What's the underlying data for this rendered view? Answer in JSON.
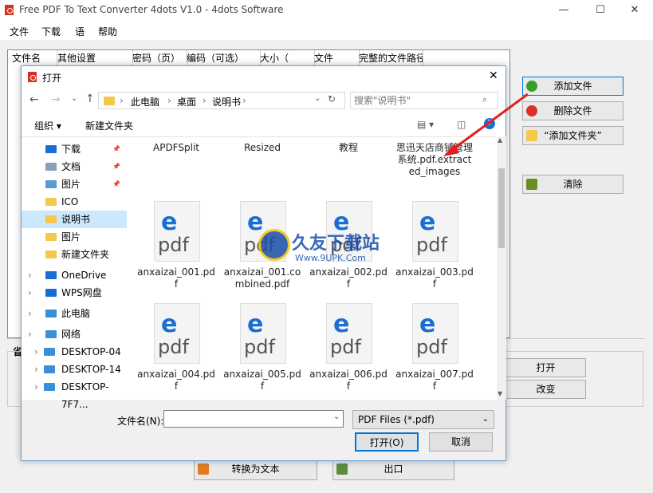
{
  "app": {
    "title": "Free PDF To Text Converter 4dots V1.0 - 4dots Software",
    "menu": [
      "文件",
      "下载",
      "语",
      "帮助"
    ],
    "columns": [
      "文件名",
      "其他设置",
      "密码（页）",
      "编码（可选）",
      "大小（",
      "文件",
      "完整的文件路径"
    ],
    "buttons": {
      "add_file": "添加文件",
      "delete_file": "删除文件",
      "add_folder": "“添加文件夹”",
      "clear": "清除",
      "open": "打开",
      "change": "改变",
      "convert": "转换为文本",
      "exit": "出口"
    },
    "section_marker": "省"
  },
  "dialog": {
    "title": "打开",
    "breadcrumb": [
      "此电脑",
      "桌面",
      "说明书"
    ],
    "search_placeholder": "搜索\"说明书\"",
    "organize": "组织 ▾",
    "new_folder": "新建文件夹",
    "nav": [
      {
        "label": "下载",
        "icon": "download-icon",
        "pinned": true
      },
      {
        "label": "文档",
        "icon": "document-icon",
        "pinned": true
      },
      {
        "label": "图片",
        "icon": "picture-icon",
        "pinned": true
      },
      {
        "label": "ICO",
        "icon": "folder-icon"
      },
      {
        "label": "说明书",
        "icon": "folder-icon",
        "selected": true
      },
      {
        "label": "图片",
        "icon": "folder-icon"
      },
      {
        "label": "新建文件夹",
        "icon": "folder-icon"
      },
      {
        "label": "OneDrive",
        "icon": "cloud-icon"
      },
      {
        "label": "WPS网盘",
        "icon": "cloud-icon"
      },
      {
        "label": "此电脑",
        "icon": "pc-icon"
      },
      {
        "label": "网络",
        "icon": "network-icon"
      },
      {
        "label": "DESKTOP-04",
        "icon": "monitor-icon"
      },
      {
        "label": "DESKTOP-14",
        "icon": "monitor-icon"
      },
      {
        "label": "DESKTOP-7F7...",
        "icon": "monitor-icon"
      }
    ],
    "folders": [
      "APDFSplit",
      "Resized",
      "教程",
      "思迅天店商铺管理系统.pdf.extracted_images"
    ],
    "files": [
      "anxaizai_001.pdf",
      "anxaizai_001.combined.pdf",
      "anxaizai_002.pdf",
      "anxaizai_003.pdf",
      "anxaizai_004.pdf",
      "anxaizai_005.pdf",
      "anxaizai_006.pdf",
      "anxaizai_007.pdf"
    ],
    "filename_label": "文件名(N):",
    "filename_value": "",
    "filter": "PDF Files (*.pdf)",
    "open_button": "打开(O)",
    "cancel_button": "取消"
  },
  "watermark": {
    "brand": "久友下载站",
    "url": "Www.9UPK.Com"
  },
  "colors": {
    "accent": "#0078d7",
    "arrow": "#e02020",
    "folder": "#f5c84c"
  }
}
